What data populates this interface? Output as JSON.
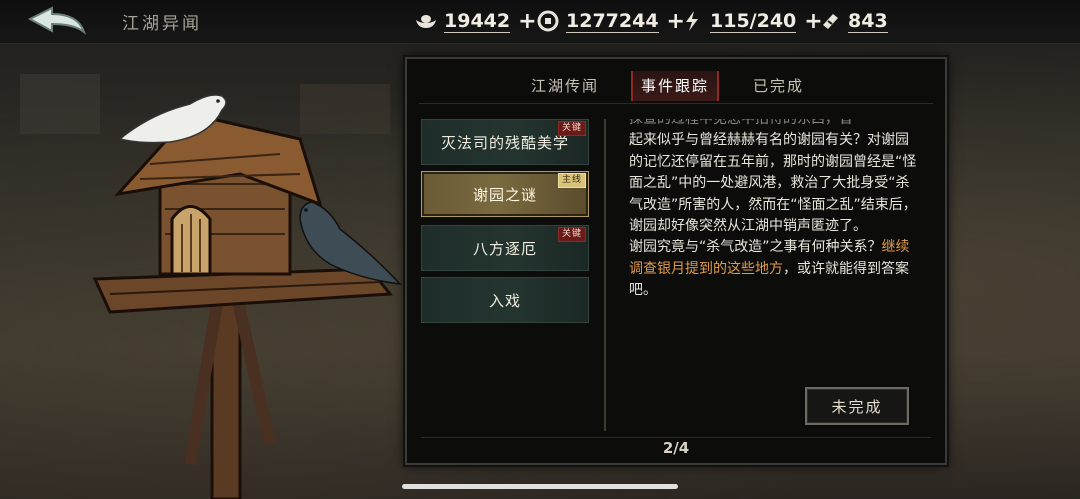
{
  "header": {
    "title": "江湖异闻",
    "resources": [
      {
        "icon": "silver-ingot-icon",
        "value": "19442"
      },
      {
        "icon": "copper-coin-icon",
        "value": "1277244"
      },
      {
        "icon": "lightning-energy-icon",
        "value": "115/240"
      },
      {
        "icon": "ticket-icon",
        "value": "843"
      }
    ]
  },
  "tabs": [
    {
      "label": "江湖传闻",
      "active": false
    },
    {
      "label": "事件跟踪",
      "active": true
    },
    {
      "label": "已完成",
      "active": false
    }
  ],
  "events": [
    {
      "label": "灭法司的残酷美学",
      "badge": "关键",
      "active": false
    },
    {
      "label": "谢园之谜",
      "badge": "主线",
      "active": true
    },
    {
      "label": "八方逐厄",
      "badge": "关键",
      "active": false
    },
    {
      "label": "入戏",
      "badge": "",
      "active": false
    }
  ],
  "detail": {
    "text_faded": "探查的过程中见您中招待的东西，曾",
    "text_main": "起来似乎与曾经赫赫有名的谢园有关？对谢园的记忆还停留在五年前，那时的谢园曾经是“怪面之乱”中的一处避风港，救治了大批身受“杀气改造”所害的人，然而在“怪面之乱”结束后，谢园却好像突然从江湖中销声匿迹了。",
    "text_question": "谢园究竟与“杀气改造”之事有何种关系？",
    "text_highlight": "继续调查银月提到的这些地方",
    "text_end": "，或许就能得到答案吧。",
    "status_button": "未完成"
  },
  "pagination": "2/4",
  "colors": {
    "accent_red": "#8d2a22",
    "highlight_orange": "#e19a4a",
    "active_gold": "#7a6a40",
    "item_green": "#243530"
  }
}
